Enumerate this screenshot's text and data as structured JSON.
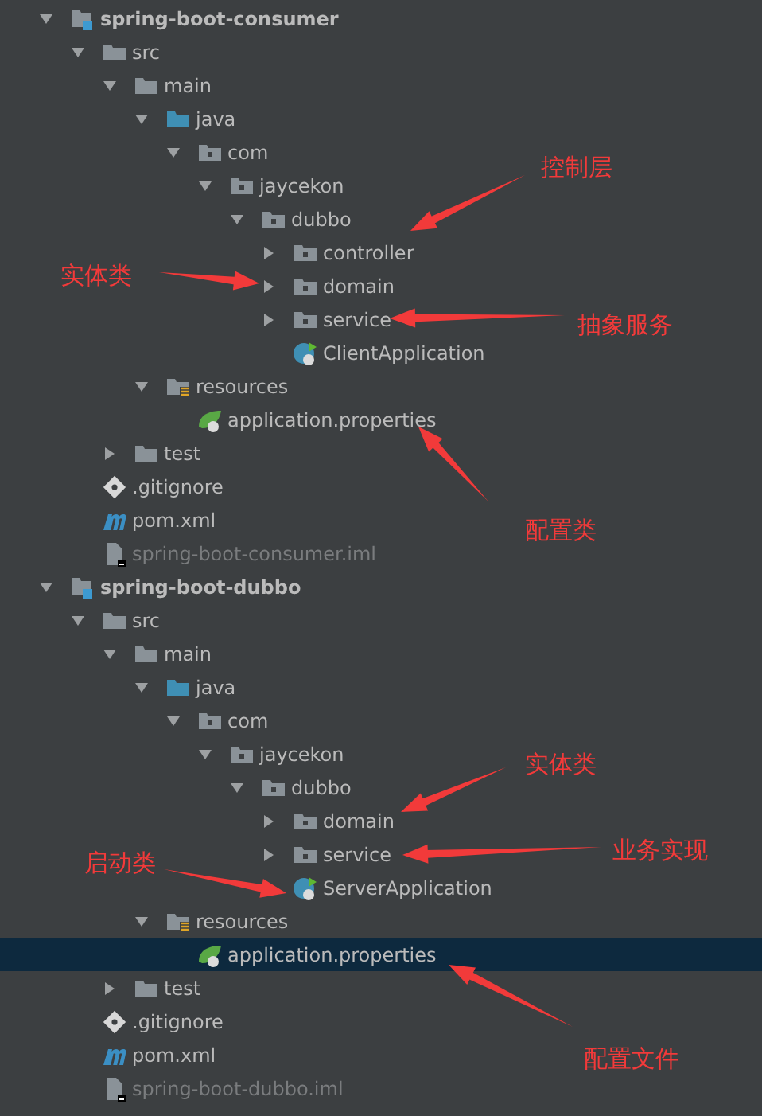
{
  "project_tree": [
    {
      "label": "spring-boot-consumer",
      "kind": "module",
      "expanded": true,
      "selected": false,
      "children": [
        {
          "label": "src",
          "kind": "folder",
          "expanded": true,
          "selected": false,
          "children": [
            {
              "label": "main",
              "kind": "folder",
              "expanded": true,
              "selected": false,
              "children": [
                {
                  "label": "java",
                  "kind": "source",
                  "expanded": true,
                  "selected": false,
                  "children": [
                    {
                      "label": "com",
                      "kind": "package",
                      "expanded": true,
                      "selected": false,
                      "children": [
                        {
                          "label": "jaycekon",
                          "kind": "package",
                          "expanded": true,
                          "selected": false,
                          "children": [
                            {
                              "label": "dubbo",
                              "kind": "package",
                              "expanded": true,
                              "selected": false,
                              "children": [
                                {
                                  "label": "controller",
                                  "kind": "package",
                                  "expanded": false,
                                  "selected": false
                                },
                                {
                                  "label": "domain",
                                  "kind": "package",
                                  "expanded": false,
                                  "selected": false
                                },
                                {
                                  "label": "service",
                                  "kind": "package",
                                  "expanded": false,
                                  "selected": false
                                },
                                {
                                  "label": "ClientApplication",
                                  "kind": "boot-class",
                                  "selected": false
                                }
                              ]
                            }
                          ]
                        }
                      ]
                    }
                  ]
                },
                {
                  "label": "resources",
                  "kind": "resources",
                  "expanded": true,
                  "selected": false,
                  "children": [
                    {
                      "label": "application.properties",
                      "kind": "properties",
                      "selected": false
                    }
                  ]
                }
              ]
            },
            {
              "label": "test",
              "kind": "folder",
              "expanded": false,
              "selected": false
            }
          ]
        },
        {
          "label": ".gitignore",
          "kind": "git",
          "selected": false
        },
        {
          "label": "pom.xml",
          "kind": "maven",
          "selected": false
        },
        {
          "label": "spring-boot-consumer.iml",
          "kind": "iml",
          "selected": false
        }
      ]
    },
    {
      "label": "spring-boot-dubbo",
      "kind": "module",
      "expanded": true,
      "selected": false,
      "children": [
        {
          "label": "src",
          "kind": "folder",
          "expanded": true,
          "selected": false,
          "children": [
            {
              "label": "main",
              "kind": "folder",
              "expanded": true,
              "selected": false,
              "children": [
                {
                  "label": "java",
                  "kind": "source",
                  "expanded": true,
                  "selected": false,
                  "children": [
                    {
                      "label": "com",
                      "kind": "package",
                      "expanded": true,
                      "selected": false,
                      "children": [
                        {
                          "label": "jaycekon",
                          "kind": "package",
                          "expanded": true,
                          "selected": false,
                          "children": [
                            {
                              "label": "dubbo",
                              "kind": "package",
                              "expanded": true,
                              "selected": false,
                              "children": [
                                {
                                  "label": "domain",
                                  "kind": "package",
                                  "expanded": false,
                                  "selected": false
                                },
                                {
                                  "label": "service",
                                  "kind": "package",
                                  "expanded": false,
                                  "selected": false
                                },
                                {
                                  "label": "ServerApplication",
                                  "kind": "boot-class",
                                  "selected": false
                                }
                              ]
                            }
                          ]
                        }
                      ]
                    }
                  ]
                },
                {
                  "label": "resources",
                  "kind": "resources",
                  "expanded": true,
                  "selected": false,
                  "children": [
                    {
                      "label": "application.properties",
                      "kind": "properties",
                      "selected": true
                    }
                  ]
                }
              ]
            },
            {
              "label": "test",
              "kind": "folder",
              "expanded": false,
              "selected": false
            }
          ]
        },
        {
          "label": ".gitignore",
          "kind": "git",
          "selected": false
        },
        {
          "label": "pom.xml",
          "kind": "maven",
          "selected": false
        },
        {
          "label": "spring-boot-dubbo.iml",
          "kind": "iml",
          "selected": false
        }
      ]
    }
  ],
  "annotations": [
    "控制层",
    "实体类",
    "抽象服务",
    "配置类",
    "实体类",
    "业务实现",
    "启动类",
    "配置文件"
  ]
}
